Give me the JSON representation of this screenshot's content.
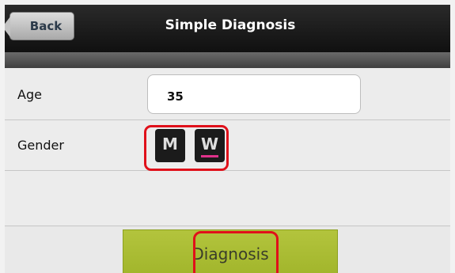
{
  "header": {
    "title": "Simple Diagnosis",
    "back_label": "Back"
  },
  "form": {
    "age_label": "Age",
    "age_value": "35",
    "gender_label": "Gender",
    "gender_options": [
      "M",
      "W"
    ],
    "selected_gender": "W"
  },
  "actions": {
    "diagnosis_label": "Diagnosis"
  },
  "colors": {
    "highlight": "#e0101a",
    "selected_indicator": "#e0318a",
    "diagnosis_button": "#a8bb32"
  }
}
